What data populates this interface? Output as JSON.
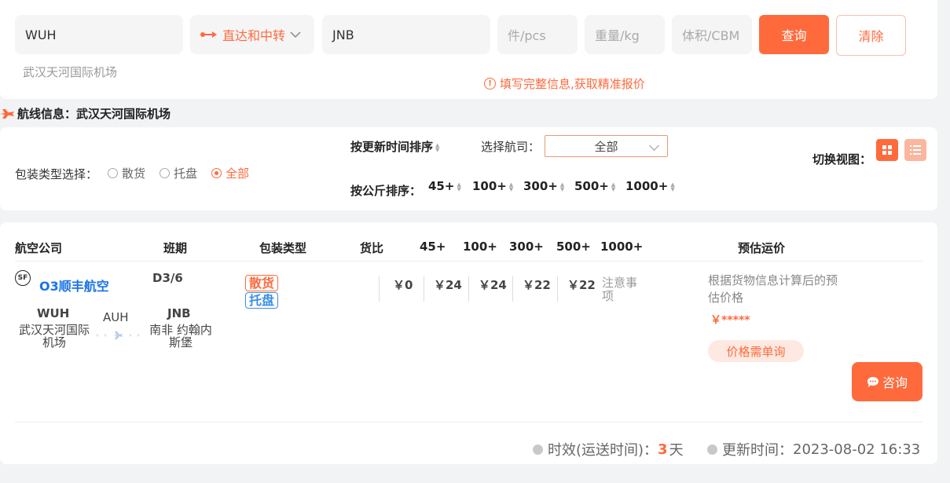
{
  "search": {
    "origin": "WUH",
    "mode": "直达和中转",
    "destination": "JNB",
    "pcs_placeholder": "件/pcs",
    "weight_placeholder": "重量/kg",
    "volume_placeholder": "体积/CBM",
    "query_label": "查询",
    "clear_label": "清除",
    "origin_airport": "武汉天河国际机场",
    "warning": "填写完整信息,获取精准报价"
  },
  "route": {
    "title": "航线信息：武汉天河国际机场"
  },
  "filters": {
    "sort_time_label": "按更新时间排序",
    "airline_label": "选择航司：",
    "airline_selected": "全部",
    "view_label": "切换视图：",
    "pack_label": "包装类型选择：",
    "pack_options": [
      "散货",
      "托盘",
      "全部"
    ],
    "pack_selected": "全部",
    "sort_kg_label": "按公斤排序：",
    "kg_options": [
      "45+",
      "100+",
      "300+",
      "500+",
      "1000+"
    ]
  },
  "table": {
    "headers": {
      "airline": "航空公司",
      "schedule": "班期",
      "package": "包装类型",
      "ratio": "货比",
      "k45": "45+",
      "k100": "100+",
      "k300": "300+",
      "k500": "500+",
      "k1000": "1000+",
      "estimate": "预估运价"
    },
    "row": {
      "logo": "SF",
      "airline": "O3顺丰航空",
      "schedule": "D3/6",
      "package_tags": [
        "散货",
        "托盘"
      ],
      "prices": [
        "￥0",
        "￥24",
        "￥24",
        "￥22",
        "￥22"
      ],
      "note": "注意事项",
      "from_code": "WUH",
      "from_name": "武汉天河国际机场",
      "via_code": "AUH",
      "to_code": "JNB",
      "to_name": "南非 约翰内斯堡",
      "estimate_text": "根据货物信息计算后的预估价格",
      "estimate_price": "￥*****",
      "price_badge": "价格需单询",
      "consult_label": "咨询",
      "transit_label": "时效(运送时间)：",
      "transit_value": "3",
      "transit_unit": "天",
      "updated_label": "更新时间：",
      "updated_value": "2023-08-02 16:33"
    }
  },
  "colors": {
    "accent": "#ff6a3d",
    "link": "#1a73e8",
    "tag_blue": "#3a8ee6"
  }
}
